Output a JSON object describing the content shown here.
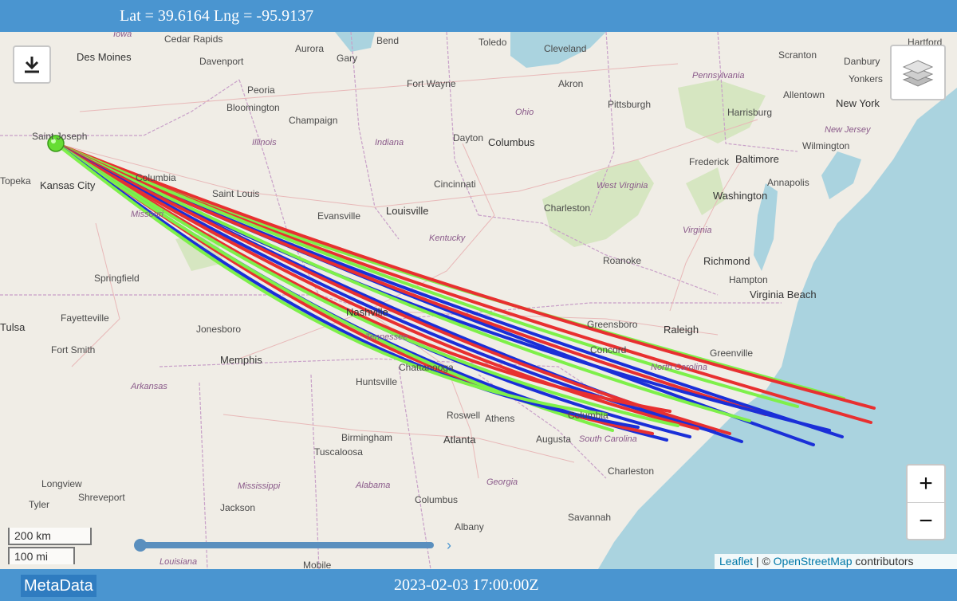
{
  "header": {
    "coords": "Lat = 39.6164 Lng = -95.9137"
  },
  "footer": {
    "metadata_label": "MetaData",
    "timestamp": "2023-02-03 17:00:00Z"
  },
  "attribution": {
    "leaflet": "Leaflet",
    "separator": "| ©",
    "osm": "OpenStreetMap",
    "suffix": "contributors"
  },
  "scale": {
    "km": "200 km",
    "mi": "100 mi"
  },
  "controls": {
    "zoom_in": "+",
    "zoom_out": "−"
  },
  "icons": {
    "download": "download-icon",
    "layers": "layers-icon",
    "launch": "launch-point-icon"
  },
  "colors": {
    "bar": "#4a95d0",
    "red": "#e83030",
    "green": "#7ef04a",
    "blue": "#1a2fd8",
    "water": "#aad3df"
  },
  "cities": [
    {
      "name": "Des Moines"
    },
    {
      "name": "Cedar Rapids"
    },
    {
      "name": "Davenport"
    },
    {
      "name": "Aurora"
    },
    {
      "name": "Gary"
    },
    {
      "name": "Bend"
    },
    {
      "name": "Toledo"
    },
    {
      "name": "Cleveland"
    },
    {
      "name": "Akron"
    },
    {
      "name": "Fort Wayne"
    },
    {
      "name": "Peoria"
    },
    {
      "name": "Bloomington"
    },
    {
      "name": "Champaign"
    },
    {
      "name": "Pittsburgh"
    },
    {
      "name": "Dayton"
    },
    {
      "name": "Columbus"
    },
    {
      "name": "Saint Joseph"
    },
    {
      "name": "Kansas City"
    },
    {
      "name": "Columbia"
    },
    {
      "name": "Saint Louis"
    },
    {
      "name": "Cincinnati"
    },
    {
      "name": "Louisville"
    },
    {
      "name": "Charleston"
    },
    {
      "name": "Evansville"
    },
    {
      "name": "Springfield"
    },
    {
      "name": "Roanoke"
    },
    {
      "name": "Richmond"
    },
    {
      "name": "Hampton"
    },
    {
      "name": "Virginia Beach"
    },
    {
      "name": "Fayetteville"
    },
    {
      "name": "Tulsa"
    },
    {
      "name": "Jonesboro"
    },
    {
      "name": "Nashville"
    },
    {
      "name": "Greensboro"
    },
    {
      "name": "Raleigh"
    },
    {
      "name": "Greenville"
    },
    {
      "name": "Concord"
    },
    {
      "name": "Fort Smith"
    },
    {
      "name": "Memphis"
    },
    {
      "name": "Chattanooga"
    },
    {
      "name": "Huntsville"
    },
    {
      "name": "Roswell"
    },
    {
      "name": "Athens"
    },
    {
      "name": "Birmingham"
    },
    {
      "name": "Atlanta"
    },
    {
      "name": "Augusta"
    },
    {
      "name": "Columbia"
    },
    {
      "name": "Tuscaloosa"
    },
    {
      "name": "Charleston"
    },
    {
      "name": "Longview"
    },
    {
      "name": "Shreveport"
    },
    {
      "name": "Tyler"
    },
    {
      "name": "Jackson"
    },
    {
      "name": "Columbus"
    },
    {
      "name": "Savannah"
    },
    {
      "name": "Albany"
    },
    {
      "name": "Mobile"
    },
    {
      "name": "Scranton"
    },
    {
      "name": "Hartford"
    },
    {
      "name": "Danbury"
    },
    {
      "name": "Yonkers"
    },
    {
      "name": "New York"
    },
    {
      "name": "Allentown"
    },
    {
      "name": "Harrisburg"
    },
    {
      "name": "Wilmington"
    },
    {
      "name": "Frederick"
    },
    {
      "name": "Baltimore"
    },
    {
      "name": "Annapolis"
    },
    {
      "name": "Washington"
    },
    {
      "name": "Topeka"
    }
  ],
  "states": [
    {
      "name": "Iowa"
    },
    {
      "name": "Illinois"
    },
    {
      "name": "Indiana"
    },
    {
      "name": "Ohio"
    },
    {
      "name": "Pennsylvania"
    },
    {
      "name": "New Jersey"
    },
    {
      "name": "West Virginia"
    },
    {
      "name": "Virginia"
    },
    {
      "name": "Missouri"
    },
    {
      "name": "Kentucky"
    },
    {
      "name": "Tennessee"
    },
    {
      "name": "North Carolina"
    },
    {
      "name": "Arkansas"
    },
    {
      "name": "South Carolina"
    },
    {
      "name": "Georgia"
    },
    {
      "name": "Mississippi"
    },
    {
      "name": "Alabama"
    },
    {
      "name": "Louisiana"
    }
  ]
}
